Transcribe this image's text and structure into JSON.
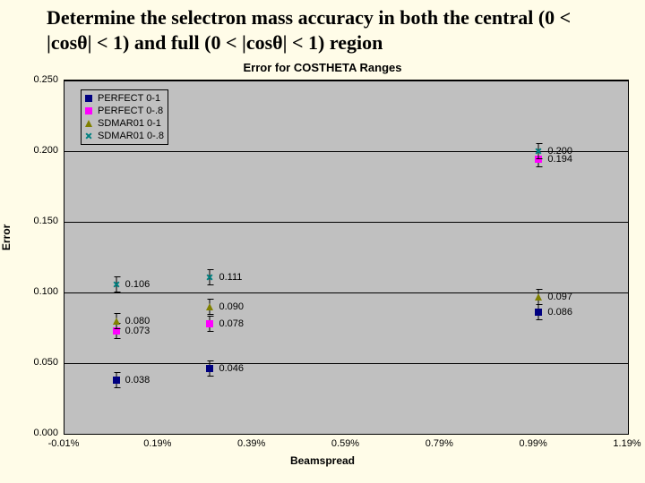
{
  "headline": "Determine the selectron mass accuracy in both the central (0 < |cosθ| < 1) and full (0 < |cosθ| < 1) region",
  "chart_data": {
    "type": "scatter",
    "title": "Error for COSTHETA Ranges",
    "xlabel": "Beamspread",
    "ylabel": "Error",
    "ylim": [
      0.0,
      0.25
    ],
    "xlim": [
      -0.0001,
      0.0119
    ],
    "yticks": [
      "0.000",
      "0.050",
      "0.100",
      "0.150",
      "0.200",
      "0.250"
    ],
    "xticks": [
      "-0.01%",
      "0.19%",
      "0.39%",
      "0.59%",
      "0.79%",
      "0.99%",
      "1.19%"
    ],
    "legend": {
      "items": [
        {
          "name": "PERFECT 0-1",
          "marker": "sq-navy"
        },
        {
          "name": "PERFECT 0-.8",
          "marker": "sq-pink"
        },
        {
          "name": "SDMAR01 0-1",
          "marker": "tri-oliv"
        },
        {
          "name": "SDMAR01 0-.8",
          "marker": "x-teal"
        }
      ]
    },
    "series": [
      {
        "name": "PERFECT 0-1",
        "marker": "sq-navy",
        "x": [
          0.001,
          0.003,
          0.01
        ],
        "y": [
          0.038,
          0.046,
          0.086
        ]
      },
      {
        "name": "PERFECT 0-.8",
        "marker": "sq-pink",
        "x": [
          0.001,
          0.003,
          0.01
        ],
        "y": [
          0.073,
          0.078,
          0.194
        ]
      },
      {
        "name": "SDMAR01 0-1",
        "marker": "tri-oliv",
        "x": [
          0.001,
          0.003,
          0.01
        ],
        "y": [
          0.08,
          0.09,
          0.097
        ]
      },
      {
        "name": "SDMAR01 0-.8",
        "marker": "x-teal",
        "x": [
          0.001,
          0.003,
          0.01
        ],
        "y": [
          0.106,
          0.111,
          0.2
        ]
      }
    ],
    "labels": [
      {
        "x": 0.001,
        "y": 0.038,
        "text": "0.038"
      },
      {
        "x": 0.001,
        "y": 0.073,
        "text": "0.073"
      },
      {
        "x": 0.001,
        "y": 0.08,
        "text": "0.080"
      },
      {
        "x": 0.001,
        "y": 0.106,
        "text": "0.106"
      },
      {
        "x": 0.003,
        "y": 0.046,
        "text": "0.046"
      },
      {
        "x": 0.003,
        "y": 0.078,
        "text": "0.078"
      },
      {
        "x": 0.003,
        "y": 0.09,
        "text": "0.090"
      },
      {
        "x": 0.003,
        "y": 0.111,
        "text": "0.111"
      },
      {
        "x": 0.01,
        "y": 0.086,
        "text": "0.086"
      },
      {
        "x": 0.01,
        "y": 0.097,
        "text": "0.097"
      },
      {
        "x": 0.01,
        "y": 0.194,
        "text": "0.194"
      },
      {
        "x": 0.01,
        "y": 0.2,
        "text": "0.200"
      }
    ]
  }
}
